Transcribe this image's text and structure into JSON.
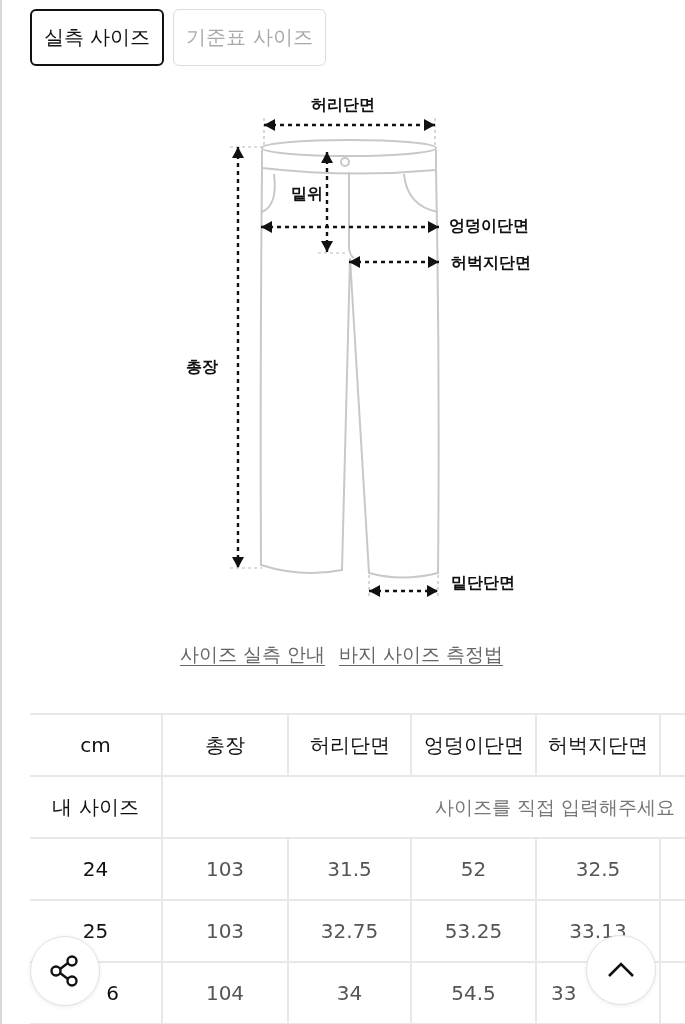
{
  "tabs": [
    {
      "label": "실측 사이즈",
      "selected": true
    },
    {
      "label": "기준표 사이즈",
      "selected": false
    }
  ],
  "diagram": {
    "labels": [
      "허리단면",
      "밑위",
      "엉덩이단면",
      "허벅지단면",
      "총장",
      "밑단단면"
    ]
  },
  "links": [
    "사이즈 실측 안내",
    "바지 사이즈 측정법"
  ],
  "table": {
    "columns": [
      "cm",
      "총장",
      "허리단면",
      "엉덩이단면",
      "허벅지단면"
    ],
    "my_size": {
      "label": "내 사이즈",
      "placeholder": "사이즈를 직접 입력해주세요"
    },
    "rows": [
      {
        "cells": [
          "24",
          "103",
          "31.5",
          "52",
          "32.5"
        ]
      },
      {
        "cells": [
          "25",
          "103",
          "32.75",
          "53.25",
          "33.13"
        ]
      },
      {
        "cells": [
          "6",
          "104",
          "34",
          "54.5",
          "33"
        ]
      }
    ]
  }
}
